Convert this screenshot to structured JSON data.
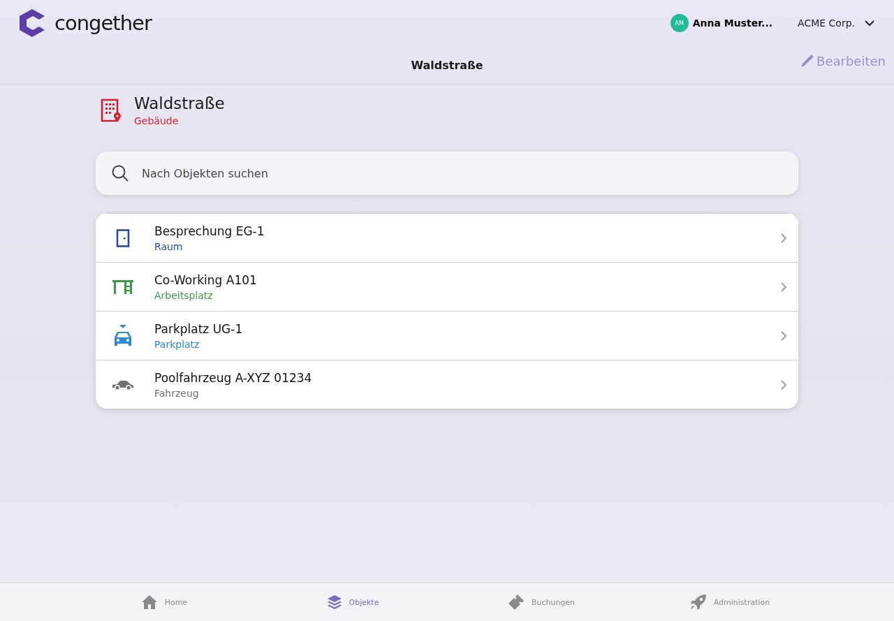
{
  "header": {
    "logo": "congether",
    "user": {
      "initials": "AM",
      "name": "Anna Muster..."
    },
    "organization": "ACME Corp.",
    "page_title": "Waldstraße",
    "edit_label": "Bearbeiten"
  },
  "building": {
    "name": "Waldstraße",
    "type": "Gebäude"
  },
  "search": {
    "placeholder": "Nach Objekten suchen"
  },
  "objects": [
    {
      "kind": "room",
      "name": "Besprechung EG-1",
      "type": "Raum",
      "color": "#2a4a9c"
    },
    {
      "kind": "desk",
      "name": "Co-Working A101",
      "type": "Arbeitsplatz",
      "color": "#3d9a4a"
    },
    {
      "kind": "parking",
      "name": "Parkplatz UG-1",
      "type": "Parkplatz",
      "color": "#2f8bd0"
    },
    {
      "kind": "vehicle",
      "name": "Poolfahrzeug A-XYZ 01234",
      "type": "Fahrzeug",
      "color": "#707070"
    }
  ],
  "nav": [
    {
      "kind": "home",
      "label": "Home",
      "selected": false
    },
    {
      "kind": "objects",
      "label": "Objekte",
      "selected": true
    },
    {
      "kind": "bookings",
      "label": "Buchungen",
      "selected": false
    },
    {
      "kind": "admin",
      "label": "Administration",
      "selected": false
    }
  ]
}
